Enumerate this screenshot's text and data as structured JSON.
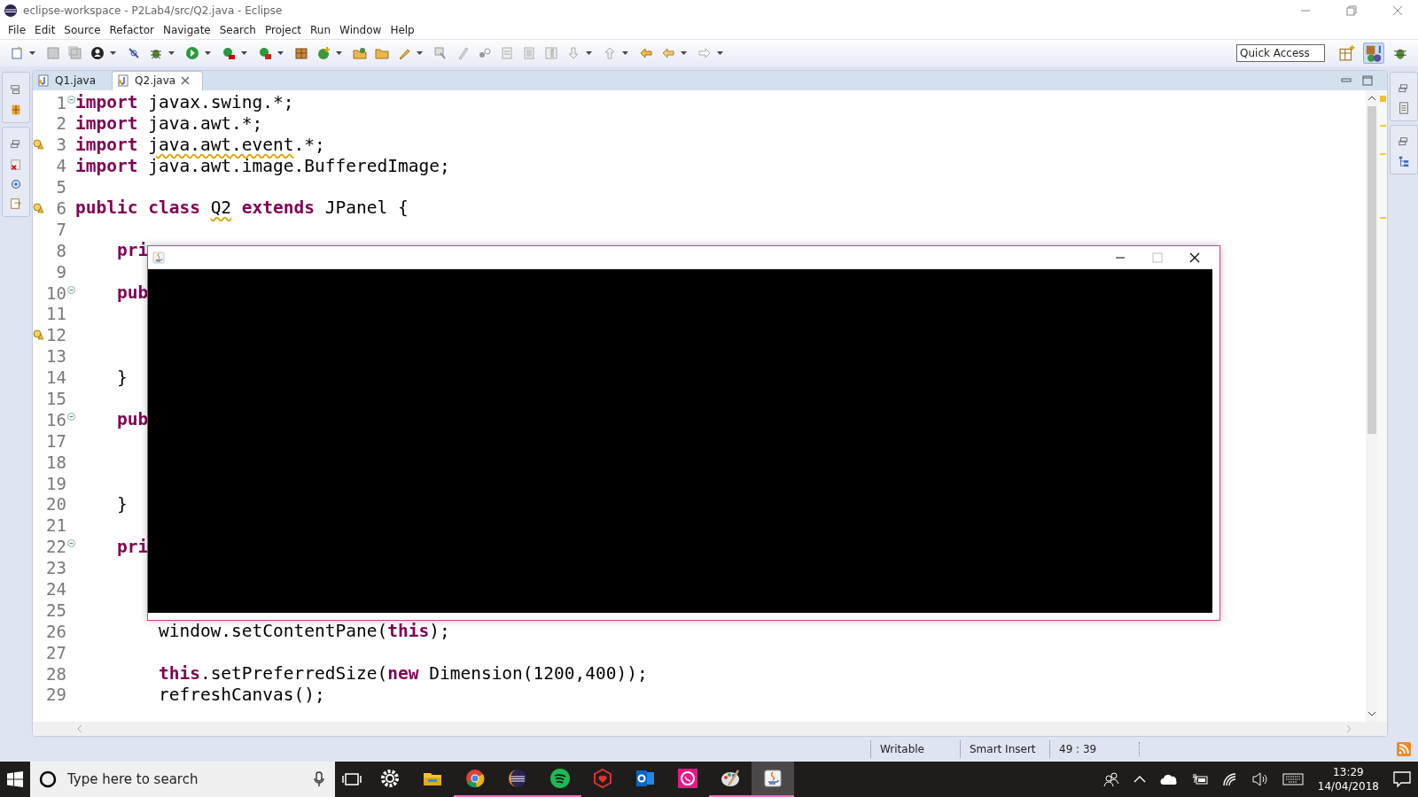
{
  "window": {
    "title": "eclipse-workspace - P2Lab4/src/Q2.java - Eclipse"
  },
  "menu": [
    "File",
    "Edit",
    "Source",
    "Refactor",
    "Navigate",
    "Search",
    "Project",
    "Run",
    "Window",
    "Help"
  ],
  "quick_access": {
    "placeholder": "Quick Access"
  },
  "tabs": [
    {
      "label": "Q1.java",
      "selected": false
    },
    {
      "label": "Q2.java",
      "selected": true
    }
  ],
  "editor": {
    "lines": [
      {
        "number": "1",
        "fold": true,
        "warning": false,
        "tokens": [
          {
            "text": "import ",
            "kind": "keyword"
          },
          {
            "text": "javax.swing.*;",
            "kind": "plain"
          }
        ]
      },
      {
        "number": "2",
        "fold": false,
        "warning": false,
        "tokens": [
          {
            "text": "import ",
            "kind": "keyword"
          },
          {
            "text": "java.awt.*;",
            "kind": "plain"
          }
        ]
      },
      {
        "number": "3",
        "fold": false,
        "warning": true,
        "tokens": [
          {
            "text": "import ",
            "kind": "keyword"
          },
          {
            "text": "java.awt.event",
            "kind": "flagged"
          },
          {
            "text": ".*;",
            "kind": "plain"
          }
        ]
      },
      {
        "number": "4",
        "fold": false,
        "warning": false,
        "tokens": [
          {
            "text": "import ",
            "kind": "keyword"
          },
          {
            "text": "java.awt.image.BufferedImage;",
            "kind": "plain"
          }
        ]
      },
      {
        "number": "5",
        "fold": false,
        "warning": false
      },
      {
        "number": "6",
        "fold": false,
        "warning": true,
        "tokens": [
          {
            "text": "public class ",
            "kind": "keyword"
          },
          {
            "text": "Q2",
            "kind": "flagged"
          },
          {
            "text": " extends",
            "kind": "keyword"
          },
          {
            "text": " JPanel {",
            "kind": "plain"
          }
        ]
      },
      {
        "number": "7",
        "fold": false,
        "warning": false
      },
      {
        "number": "8",
        "fold": false,
        "warning": false,
        "tokens": [
          {
            "text": "    pri",
            "kind": "keyword"
          }
        ]
      },
      {
        "number": "9",
        "fold": false,
        "warning": false
      },
      {
        "number": "10",
        "fold": true,
        "warning": false,
        "tokens": [
          {
            "text": "    pub",
            "kind": "keyword"
          }
        ]
      },
      {
        "number": "11",
        "fold": false,
        "warning": false
      },
      {
        "number": "12",
        "fold": false,
        "warning": true
      },
      {
        "number": "13",
        "fold": false,
        "warning": false
      },
      {
        "number": "14",
        "fold": false,
        "warning": false,
        "tokens": [
          {
            "text": "    }",
            "kind": "plain"
          }
        ]
      },
      {
        "number": "15",
        "fold": false,
        "warning": false
      },
      {
        "number": "16",
        "fold": true,
        "warning": false,
        "tokens": [
          {
            "text": "    pub",
            "kind": "keyword"
          }
        ]
      },
      {
        "number": "17",
        "fold": false,
        "warning": false
      },
      {
        "number": "18",
        "fold": false,
        "warning": false
      },
      {
        "number": "19",
        "fold": false,
        "warning": false
      },
      {
        "number": "20",
        "fold": false,
        "warning": false,
        "tokens": [
          {
            "text": "    }",
            "kind": "plain"
          }
        ]
      },
      {
        "number": "21",
        "fold": false,
        "warning": false
      },
      {
        "number": "22",
        "fold": true,
        "warning": false,
        "tokens": [
          {
            "text": "    pri",
            "kind": "keyword"
          }
        ]
      },
      {
        "number": "23",
        "fold": false,
        "warning": false
      },
      {
        "number": "24",
        "fold": false,
        "warning": false
      },
      {
        "number": "25",
        "fold": false,
        "warning": false
      },
      {
        "number": "26",
        "fold": false,
        "warning": false,
        "tokens": [
          {
            "text": "        window.setContentPane(",
            "kind": "plain"
          },
          {
            "text": "this",
            "kind": "keyword"
          },
          {
            "text": ");",
            "kind": "plain"
          }
        ]
      },
      {
        "number": "27",
        "fold": false,
        "warning": false
      },
      {
        "number": "28",
        "fold": false,
        "warning": false,
        "tokens": [
          {
            "text": "        this",
            "kind": "keyword"
          },
          {
            "text": ".setPreferredSize(",
            "kind": "plain"
          },
          {
            "text": "new",
            "kind": "keyword"
          },
          {
            "text": " Dimension(1200,400));",
            "kind": "plain"
          }
        ]
      },
      {
        "number": "29",
        "fold": false,
        "warning": false,
        "tokens": [
          {
            "text": "        refreshCanvas();",
            "kind": "plain"
          }
        ]
      }
    ]
  },
  "status_bar": [
    "Writable",
    "Smart Insert",
    "49 : 39"
  ],
  "taskbar": {
    "search": {
      "placeholder": "Type here to search"
    },
    "apps": [
      {
        "kind": "settings",
        "running": false,
        "selected": false
      },
      {
        "kind": "folder",
        "running": false,
        "selected": false
      },
      {
        "kind": "chrome",
        "running": true,
        "selected": false
      },
      {
        "kind": "eclipse",
        "running": true,
        "selected": false
      },
      {
        "kind": "spotify",
        "running": true,
        "selected": false
      },
      {
        "kind": "shield",
        "running": false,
        "selected": false
      },
      {
        "kind": "mail",
        "running": false,
        "selected": false
      },
      {
        "kind": "chat",
        "running": false,
        "selected": false
      },
      {
        "kind": "palette",
        "running": true,
        "selected": false
      },
      {
        "kind": "java",
        "running": true,
        "selected": true
      }
    ],
    "time": "13:29",
    "date": "14/04/2018"
  }
}
